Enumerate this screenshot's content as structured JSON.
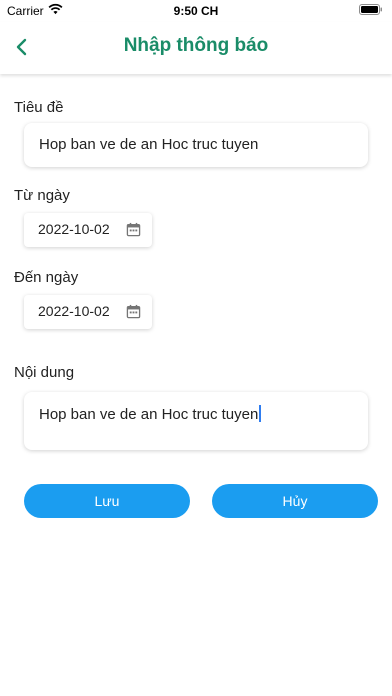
{
  "status_bar": {
    "carrier": "Carrier",
    "time": "9:50 CH"
  },
  "nav": {
    "title": "Nhập thông báo",
    "back_icon": "chevron-left-icon"
  },
  "form": {
    "title_label": "Tiêu đề",
    "title_value": "Hop ban ve de an Hoc truc tuyen",
    "from_label": "Từ ngày",
    "from_value": "2022-10-02",
    "to_label": "Đến ngày",
    "to_value": "2022-10-02",
    "content_label": "Nội dung",
    "content_value": "Hop ban ve de an Hoc truc tuyen"
  },
  "buttons": {
    "save_label": "Lưu",
    "cancel_label": "Hủy"
  },
  "colors": {
    "accent": "#1a8c68",
    "button": "#1b9df0",
    "caret": "#2f7df0"
  }
}
